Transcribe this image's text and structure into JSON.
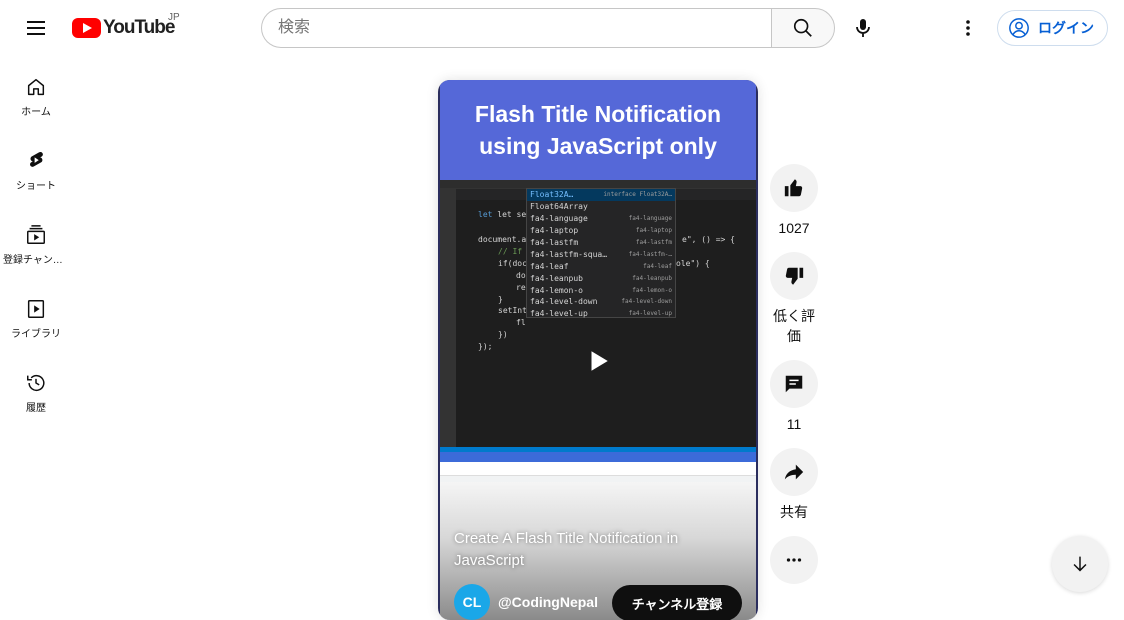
{
  "header": {
    "logo_text": "YouTube",
    "region": "JP",
    "search_placeholder": "検索",
    "login_label": "ログイン"
  },
  "sidebar": {
    "items": [
      {
        "label": "ホーム",
        "icon": "home-icon"
      },
      {
        "label": "ショート",
        "icon": "shorts-icon"
      },
      {
        "label": "登録チャンネル",
        "icon": "subscriptions-icon"
      },
      {
        "label": "ライブラリ",
        "icon": "library-icon"
      },
      {
        "label": "履歴",
        "icon": "history-icon"
      }
    ]
  },
  "short": {
    "thumb_title_line1": "Flash Title Notification",
    "thumb_title_line2": "using JavaScript only",
    "caption": "Create A Flash Title Notification in JavaScript",
    "channel_initial": "CL",
    "channel_name": "@CodingNepal",
    "subscribe_label": "チャンネル登録",
    "code": {
      "l1": "let setInt",
      "l2": "document.a",
      "l2_tail": "e\", () => {",
      "l3": "// If",
      "l4": "if(doc",
      "l4_tail": "ole\") {",
      "l5": "do",
      "l6": "re",
      "l7": "}",
      "l8": "setInt",
      "l9": "fl",
      "l10": "})",
      "l11": "});"
    },
    "autocomplete": [
      {
        "name": "Float32A…",
        "detail": "interface Float32A…"
      },
      {
        "name": "Float64Array",
        "detail": ""
      },
      {
        "name": "fa4-language",
        "detail": "fa4-language"
      },
      {
        "name": "fa4-laptop",
        "detail": "fa4-laptop"
      },
      {
        "name": "fa4-lastfm",
        "detail": "fa4-lastfm"
      },
      {
        "name": "fa4-lastfm-squa…",
        "detail": "fa4-lastfm-…"
      },
      {
        "name": "fa4-leaf",
        "detail": "fa4-leaf"
      },
      {
        "name": "fa4-leanpub",
        "detail": "fa4-leanpub"
      },
      {
        "name": "fa4-lemon-o",
        "detail": "fa4-lemon-o"
      },
      {
        "name": "fa4-level-down",
        "detail": "fa4-level-down"
      },
      {
        "name": "fa4-level-up",
        "detail": "fa4-level-up"
      }
    ]
  },
  "actions": {
    "like_count": "1027",
    "dislike_label": "低く評価",
    "comment_count": "11",
    "share_label": "共有"
  },
  "colors": {
    "brand_red": "#ff0000",
    "link_blue": "#065fd4",
    "thumb_blue": "#5568d8"
  }
}
